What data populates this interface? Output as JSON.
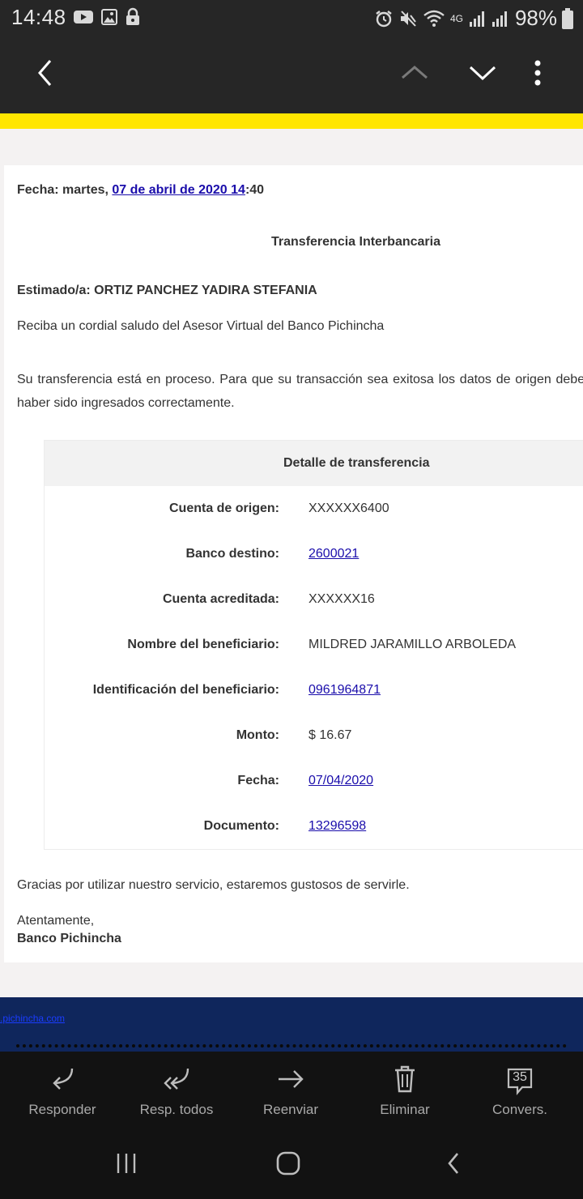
{
  "status_bar": {
    "time": "14:48",
    "network": "4G",
    "battery": "98%"
  },
  "email": {
    "fecha_prefix": "Fecha: martes, ",
    "fecha_link": "07 de abril de 2020 14",
    "fecha_suffix": ":40",
    "title": "Transferencia Interbancaria",
    "greeting": "Estimado/a: ORTIZ PANCHEZ YADIRA STEFANIA",
    "intro": "Reciba un cordial saludo del Asesor Virtual del Banco Pichincha",
    "body": "Su transferencia está en proceso. Para que su transacción sea exitosa los datos de origen deben haber sido ingresados correctamente.",
    "detail_title": "Detalle de transferencia",
    "details": [
      {
        "label": "Cuenta de origen:",
        "value": "XXXXXX6400",
        "link": false
      },
      {
        "label": "Banco destino:",
        "value": "2600021",
        "link": true
      },
      {
        "label": "Cuenta acreditada:",
        "value": "XXXXXX16",
        "link": false
      },
      {
        "label": "Nombre del beneficiario:",
        "value": "MILDRED JARAMILLO ARBOLEDA",
        "link": false
      },
      {
        "label": "Identificación del beneficiario:",
        "value": "0961964871",
        "link": true
      },
      {
        "label": "Monto:",
        "value": "$ 16.67",
        "link": false
      },
      {
        "label": "Fecha:",
        "value": "07/04/2020",
        "link": true
      },
      {
        "label": "Documento:",
        "value": "13296598",
        "link": true
      }
    ],
    "thanks": "Gracias por utilizar nuestro servicio, estaremos gustosos de servirle.",
    "regards": "Atentamente,",
    "signature": "Banco Pichincha",
    "footer_link": ".pichincha.com"
  },
  "actions": {
    "reply": "Responder",
    "reply_all": "Resp. todos",
    "forward": "Reenviar",
    "delete": "Eliminar",
    "conversation": "Convers.",
    "conversation_count": "35"
  },
  "icons": {
    "back": "chevron-left-icon",
    "prev": "chevron-up-icon",
    "next": "chevron-down-icon",
    "more": "more-vert-icon"
  },
  "colors": {
    "accent_yellow": "#ffe600",
    "footer_blue": "#0f265c",
    "link": "#1a0dab"
  }
}
